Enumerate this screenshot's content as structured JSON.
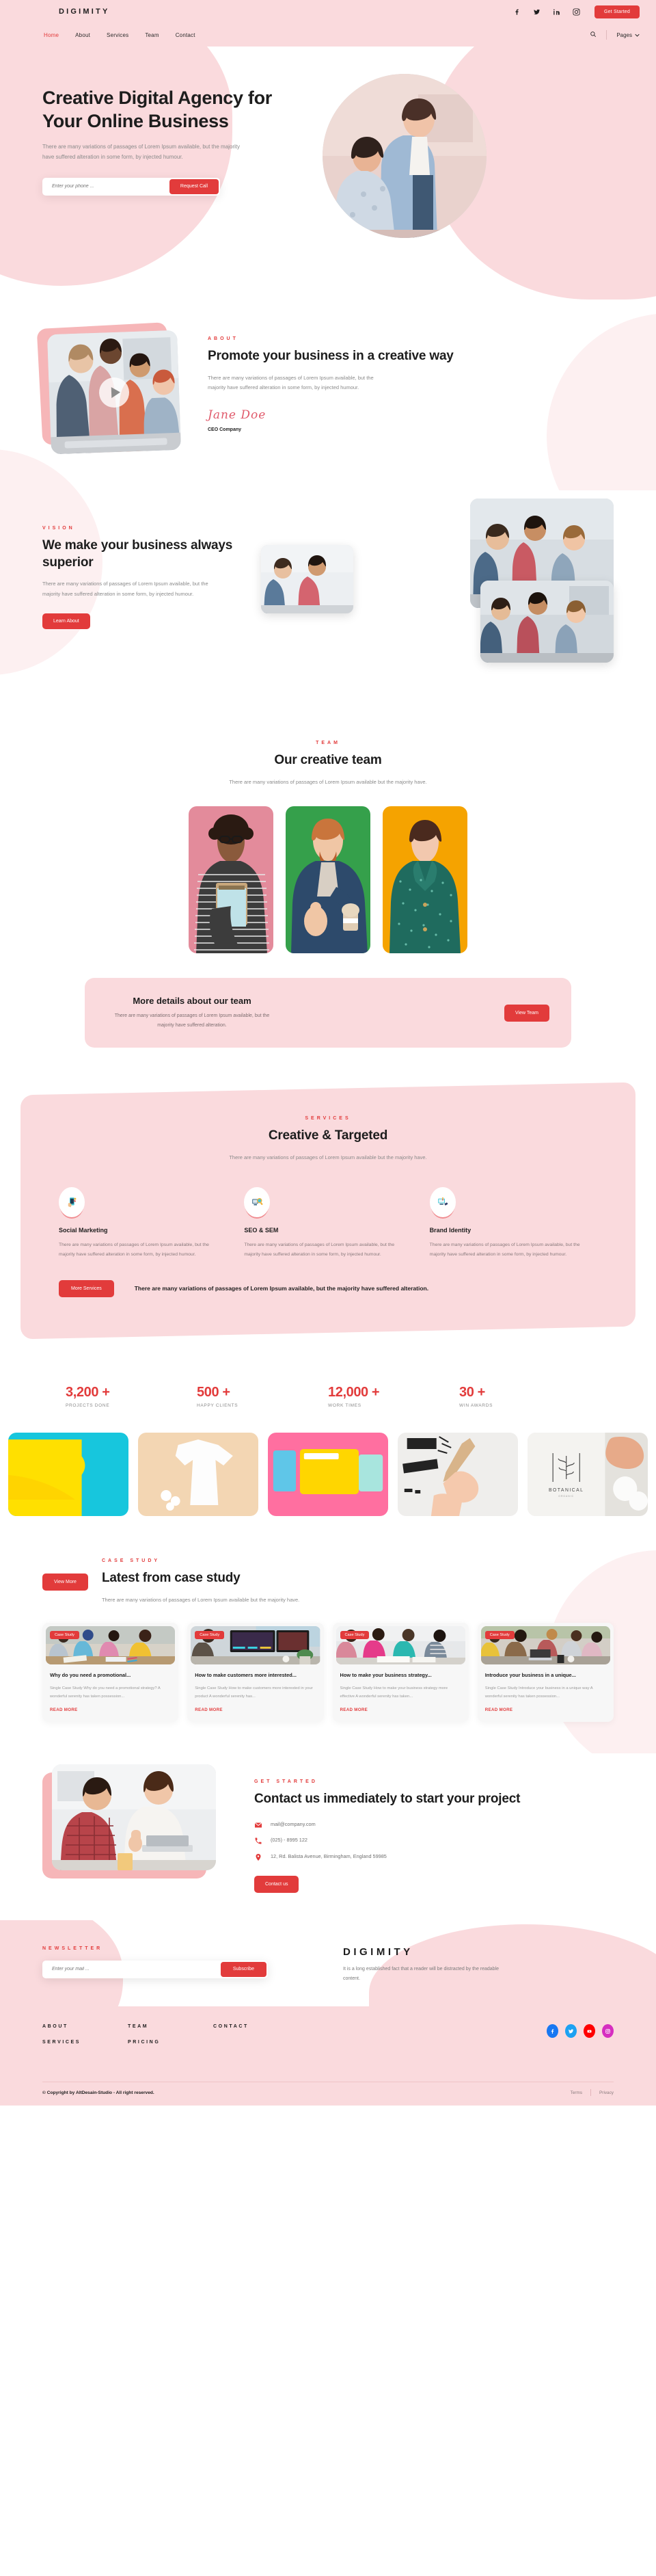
{
  "header": {
    "brand": "DIGIMITY",
    "nav": [
      {
        "label": "Home",
        "active": true
      },
      {
        "label": "About",
        "active": false
      },
      {
        "label": "Services",
        "active": false
      },
      {
        "label": "Team",
        "active": false
      },
      {
        "label": "Contact",
        "active": false
      }
    ],
    "socials": [
      "facebook-icon",
      "twitter-icon",
      "linkedin-icon",
      "instagram-icon"
    ],
    "cta_label": "Get Started",
    "search_icon": "search-icon",
    "pages_label": "Pages",
    "accent": "#e23b3b",
    "bg": "#fadadd"
  },
  "hero": {
    "title": "Creative Digital Agency for Your Online Business",
    "desc": "There are many variations of passages of Lorem Ipsum available, but the majority have suffered alteration in some form, by injected humour.",
    "input_placeholder": "Enter your phone ...",
    "button_label": "Request Call"
  },
  "about": {
    "eyebrow": "ABOUT",
    "title": "Promote your business in a creative way",
    "desc": "There are many variations of passages of Lorem Ipsum available, but the majority have suffered alteration in some form, by injected humour.",
    "signature": "Jane Doe",
    "role": "CEO Company",
    "play_icon": "play-icon"
  },
  "vision": {
    "eyebrow": "VISION",
    "title": "We make your business always superior",
    "desc": "There are many variations of passages of Lorem Ipsum available, but the majority have suffered alteration in some form, by injected humour.",
    "button_label": "Learn About"
  },
  "team": {
    "eyebrow": "TEAM",
    "title": "Our creative team",
    "desc": "There are many variations of passages of Lorem Ipsum available but the majority have.",
    "members": [
      {
        "bg": "#e38b9b",
        "alt": "team-member-1"
      },
      {
        "bg": "#35a04b",
        "alt": "team-member-2"
      },
      {
        "bg": "#f5a300",
        "alt": "team-member-3"
      }
    ],
    "banner": {
      "title": "More details about our team",
      "desc": "There are many variations of passages of Lorem Ipsum available, but the majority have suffered alteration.",
      "button_label": "View Team"
    }
  },
  "services": {
    "eyebrow": "SERVICES",
    "title": "Creative & Targeted",
    "desc": "There are many variations of passages of Lorem Ipsum available but the majority have.",
    "items": [
      {
        "icon": "mobile-marketing-icon",
        "glyph": "📱",
        "title": "Social Marketing",
        "desc": "There are many variations of passages of Lorem Ipsum available, but the majority have suffered alteration in some form, by injected humour."
      },
      {
        "icon": "search-analytics-icon",
        "glyph": "🔍",
        "title": "SEO & SEM",
        "desc": "There are many variations of passages of Lorem Ipsum available, but the majority have suffered alteration in some form, by injected humour."
      },
      {
        "icon": "design-brand-icon",
        "glyph": "🖌",
        "title": "Brand Identity",
        "desc": "There are many variations of passages of Lorem Ipsum available, but the majority have suffered alteration in some form, by injected humour."
      }
    ],
    "button_label": "More Services",
    "note": "There are many variations of passages of Lorem Ipsum available, but the majority have suffered alteration."
  },
  "stats": [
    {
      "number": "3,200 +",
      "label": "PROJECTS DONE"
    },
    {
      "number": "500 +",
      "label": "HAPPY CLIENTS"
    },
    {
      "number": "12,000 +",
      "label": "WORK TIMES"
    },
    {
      "number": "30 +",
      "label": "WIN AWARDS"
    }
  ],
  "portfolio": [
    {
      "alt": "yellow-cap-on-cyan",
      "bg": "#17c6dd",
      "accent": "#ffe000"
    },
    {
      "alt": "white-tshirt-flatlay",
      "bg": "#f3d6b3",
      "accent": "#ffffff"
    },
    {
      "alt": "yellow-folder-on-pink",
      "bg": "#ff6fa0",
      "accent": "#ffd600"
    },
    {
      "alt": "hand-lettering-sketch",
      "bg": "#efefef",
      "accent": "#2b2b2b"
    },
    {
      "alt": "botanical-packaging",
      "bg": "#e4e2dd",
      "accent": "#ffffff"
    }
  ],
  "case_study": {
    "eyebrow": "CASE STUDY",
    "title": "Latest from case study",
    "desc": "There are many variations of passages of Lorem Ipsum available but the majority have.",
    "button_label": "View More",
    "tag": "Case Study",
    "read_more": "READ MORE",
    "cards": [
      {
        "title": "Why do you need a promotional...",
        "desc": "Single Case Study Why do you need a promotional strategy? A wonderful serenity has taken possession...",
        "img_alt": "team-brainstorm-colour-samples"
      },
      {
        "title": "How to make customers more interested...",
        "desc": "Single Case Study How to make customers more interested in your product A wonderful serenity has...",
        "img_alt": "video-editor-at-desk"
      },
      {
        "title": "How to make your business strategy...",
        "desc": "Single Case Study How to make your business strategy more effective A wonderful serenity has taken...",
        "img_alt": "colleagues-reviewing-documents"
      },
      {
        "title": "Introduce your business in a unique...",
        "desc": "Single Case Study Introduce your business in a unique way A wonderful serenity has taken possession...",
        "img_alt": "office-meeting-around-table"
      }
    ]
  },
  "contact": {
    "eyebrow": "GET STARTED",
    "title": "Contact us immediately to start your project",
    "email": "mail@company.com",
    "phone": "(025) - 8995 122",
    "address": "12, Rd. Balista Avenue, Birmingham, England 59985",
    "button_label": "Contact us",
    "icons": {
      "email": "envelope-icon",
      "phone": "phone-icon",
      "address": "location-pin-icon"
    },
    "img_alt": "two-colleagues-with-laptop"
  },
  "newsletter": {
    "eyebrow": "NEWSLETTER",
    "input_placeholder": "Enter your mail ...",
    "button_label": "Subscribe",
    "brand": "DIGIMITY",
    "brand_desc": "It is a long established fact that a reader will be distracted by the readable content."
  },
  "footer": {
    "columns": [
      [
        "ABOUT",
        "SERVICES"
      ],
      [
        "TEAM",
        "PRICING"
      ],
      [
        "CONTACT"
      ]
    ],
    "socials": [
      {
        "name": "facebook-icon",
        "color": "#1877f2"
      },
      {
        "name": "twitter-icon",
        "color": "#1da1f2"
      },
      {
        "name": "youtube-icon",
        "color": "#ff0000"
      },
      {
        "name": "instagram-icon",
        "color": "#d62ec0"
      }
    ],
    "copyright": "© Copyright by AltDesain-Studio - All right reserved.",
    "terms": "Terms",
    "privacy": "Privacy"
  }
}
